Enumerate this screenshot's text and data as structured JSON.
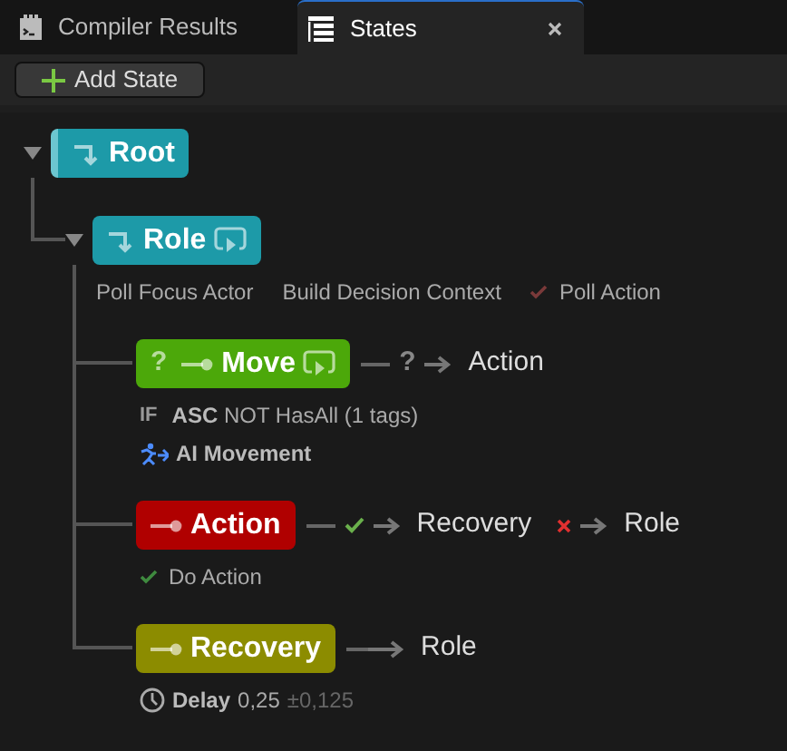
{
  "tabs": [
    {
      "label": "Compiler Results",
      "kind": "log",
      "selected": false,
      "closable": false
    },
    {
      "label": "States",
      "kind": "states",
      "selected": true,
      "closable": true
    }
  ],
  "toolbar": {
    "add_button": "Add State"
  },
  "tree": [
    {
      "name": "Root",
      "kind": "selector",
      "color": "#1d9aa8",
      "selected": true,
      "linked": false,
      "expanded": true,
      "children": [
        {
          "name": "Role",
          "kind": "selector",
          "color": "#1d9aa8",
          "selected": false,
          "linked": true,
          "expanded": true,
          "tasks": [
            {
              "kind": "task",
              "label": "Poll Focus Actor",
              "checked": false
            },
            {
              "kind": "task",
              "label": "Build Decision Context",
              "checked": false
            },
            {
              "kind": "task",
              "label": "Poll Action",
              "checked": true,
              "color": "#7a3a3a"
            }
          ],
          "children": [
            {
              "name": "Move",
              "kind": "state",
              "color": "#4ca80a",
              "selected": false,
              "linked": true,
              "prefix": "?",
              "transitions": [
                {
                  "kind": "condition",
                  "label": "?",
                  "target": "Action"
                }
              ],
              "conditions": [
                {
                  "operator": "IF",
                  "subject": "ASC",
                  "text": "NOT HasAll (1 tags)"
                }
              ],
              "tasks": [
                {
                  "kind": "movement",
                  "label": "AI Movement"
                }
              ]
            },
            {
              "name": "Action",
              "kind": "state",
              "color": "#b00000",
              "selected": false,
              "linked": false,
              "transitions": [
                {
                  "kind": "success",
                  "target": "Recovery"
                },
                {
                  "kind": "failure",
                  "target": "Role"
                }
              ],
              "tasks": [
                {
                  "kind": "task",
                  "label": "Do Action",
                  "checked": true,
                  "color": "#3f8a3f"
                }
              ]
            },
            {
              "name": "Recovery",
              "kind": "state",
              "color": "#8c8c00",
              "selected": false,
              "linked": false,
              "transitions": [
                {
                  "kind": "plain",
                  "target": "Role"
                }
              ],
              "delay": {
                "label": "Delay",
                "value": "0,25",
                "spread": "±0,125"
              }
            }
          ]
        }
      ]
    }
  ]
}
